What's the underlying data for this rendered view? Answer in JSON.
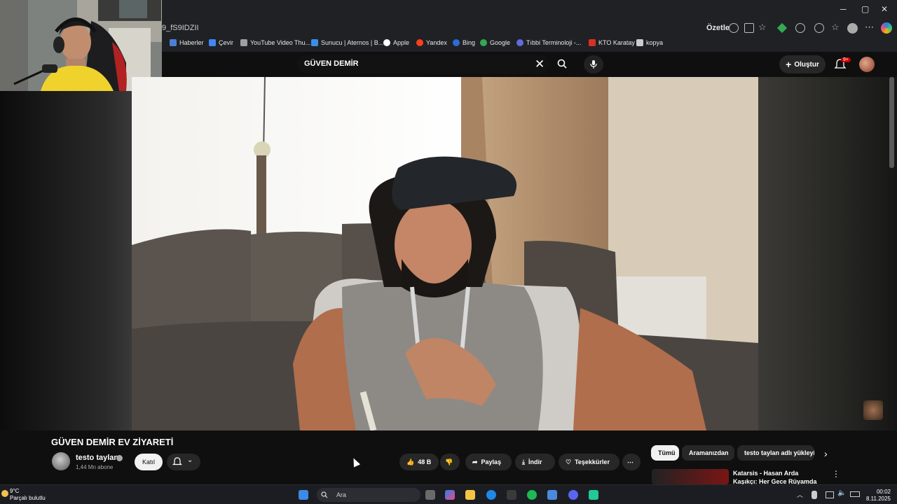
{
  "browser": {
    "url_fragment": "9_fS9IDZII",
    "summarize_label": "Özetle",
    "bookmarks": [
      {
        "label": "Haberler",
        "color": "#4a7fd6"
      },
      {
        "label": "Çevir",
        "color": "#4285f4"
      },
      {
        "label": "YouTube Video Thu...",
        "color": "#9aa0a6"
      },
      {
        "label": "Sunucu | Aternos | B...",
        "color": "#3a8ee6"
      },
      {
        "label": "Apple",
        "color": "#ffffff"
      },
      {
        "label": "Yandex",
        "color": "#fc3f1d"
      },
      {
        "label": "Bing",
        "color": "#2b6cd8"
      },
      {
        "label": "Google",
        "color": "#34a853"
      },
      {
        "label": "Tıbbi Terminoloji -...",
        "color": "#5f6ce0"
      },
      {
        "label": "KTO Karatay",
        "color": "#d93025"
      },
      {
        "label": "kopya",
        "color": "#cccccc"
      }
    ]
  },
  "youtube": {
    "search_value": "GÜVEN DEMİR",
    "create_label": "Oluştur",
    "notification_count": "9+",
    "video": {
      "title": "GÜVEN DEMİR EV ZİYARETİ",
      "channel": "testo taylan",
      "subscribers": "1,44 Mn abone",
      "join_label": "Katıl",
      "likes": "48 B",
      "share_label": "Paylaş",
      "download_label": "İndir",
      "thanks_label": "Teşekkürler"
    },
    "filters": [
      "Tümü",
      "Aramanızdan",
      "testo taylan adlı yükleyic"
    ],
    "recommendation": {
      "title": "Katarsis - Hasan Arda Kaşıkçı: Her Gece Rüyamda"
    }
  },
  "taskbar": {
    "temperature": "9°C",
    "weather": "Parçalı bulutlu",
    "search_placeholder": "Ara",
    "time": "00:02",
    "date": "8.11.2025"
  }
}
